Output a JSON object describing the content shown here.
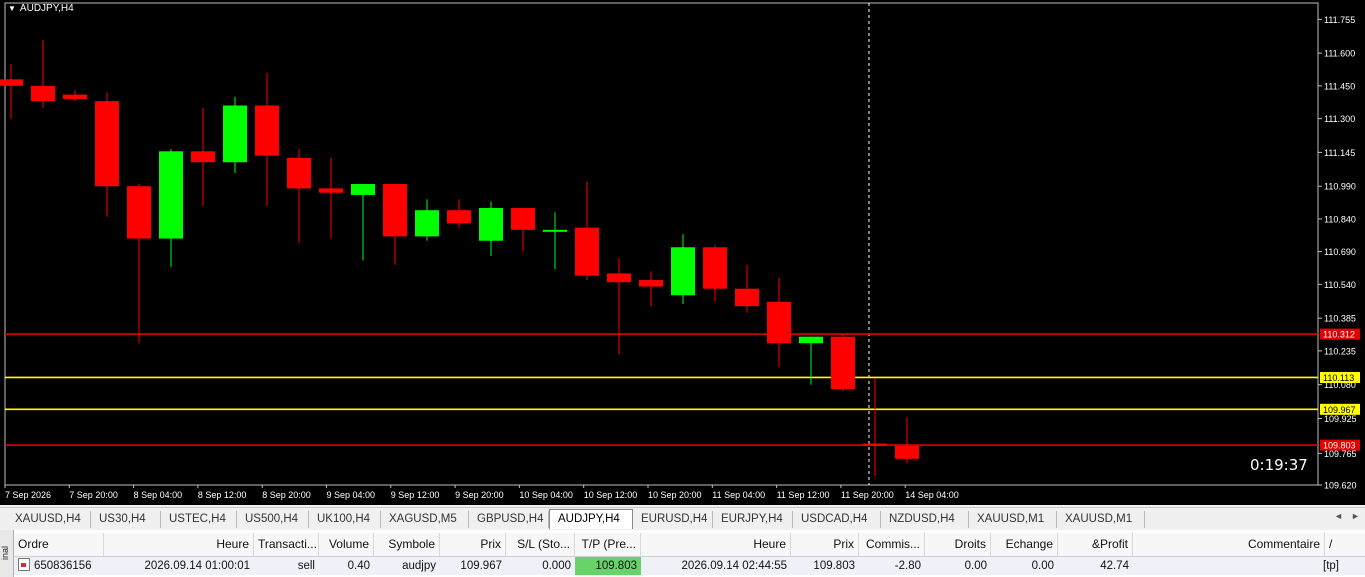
{
  "chart": {
    "title": "AUDJPY,H4",
    "countdown": "0:19:37",
    "background": "#000000",
    "bull_color": "#00ff00",
    "bear_color": "#ff0000",
    "price_axis": {
      "min": 109.62,
      "max": 111.83,
      "ticks": [
        "111.755",
        "111.600",
        "111.450",
        "111.300",
        "111.145",
        "110.990",
        "110.840",
        "110.690",
        "110.540",
        "110.385",
        "110.235",
        "110.080",
        "109.925",
        "109.765",
        "109.620"
      ]
    },
    "time_labels": [
      "7 Sep 2026",
      "7 Sep 20:00",
      "8 Sep 04:00",
      "8 Sep 12:00",
      "8 Sep 20:00",
      "9 Sep 04:00",
      "9 Sep 12:00",
      "9 Sep 20:00",
      "10 Sep 04:00",
      "10 Sep 12:00",
      "10 Sep 20:00",
      "11 Sep 04:00",
      "11 Sep 12:00",
      "11 Sep 20:00",
      "14 Sep 04:00"
    ],
    "levels": [
      {
        "price": 110.312,
        "label": "110.312",
        "color": "#e00000",
        "label_bg": "#e00000",
        "label_fg": "#ffffff"
      },
      {
        "price": 110.113,
        "label": "110.113",
        "color": "#ffff00",
        "label_bg": "#ffff00",
        "label_fg": "#000000"
      },
      {
        "price": 109.967,
        "label": "109.967",
        "color": "#ffff00",
        "label_bg": "#ffff00",
        "label_fg": "#000000"
      },
      {
        "price": 109.803,
        "label": "109.803",
        "color": "#e00000",
        "label_bg": "#e00000",
        "label_fg": "#ffffff"
      }
    ],
    "candles": [
      {
        "o": 111.48,
        "h": 111.55,
        "l": 111.3,
        "c": 111.45
      },
      {
        "o": 111.45,
        "h": 111.66,
        "l": 111.35,
        "c": 111.38
      },
      {
        "o": 111.41,
        "h": 111.43,
        "l": 111.38,
        "c": 111.39
      },
      {
        "o": 111.38,
        "h": 111.42,
        "l": 110.85,
        "c": 110.99
      },
      {
        "o": 110.99,
        "h": 111.0,
        "l": 110.27,
        "c": 110.75
      },
      {
        "o": 110.75,
        "h": 111.16,
        "l": 110.62,
        "c": 111.15
      },
      {
        "o": 111.15,
        "h": 111.35,
        "l": 110.9,
        "c": 111.1
      },
      {
        "o": 111.1,
        "h": 111.4,
        "l": 111.05,
        "c": 111.36
      },
      {
        "o": 111.36,
        "h": 111.51,
        "l": 110.9,
        "c": 111.13
      },
      {
        "o": 111.12,
        "h": 111.16,
        "l": 110.73,
        "c": 110.98
      },
      {
        "o": 110.98,
        "h": 111.12,
        "l": 110.75,
        "c": 110.96
      },
      {
        "o": 110.95,
        "h": 111.0,
        "l": 110.65,
        "c": 111.0
      },
      {
        "o": 111.0,
        "h": 111.0,
        "l": 110.63,
        "c": 110.76
      },
      {
        "o": 110.76,
        "h": 110.93,
        "l": 110.74,
        "c": 110.88
      },
      {
        "o": 110.88,
        "h": 110.93,
        "l": 110.8,
        "c": 110.82
      },
      {
        "o": 110.74,
        "h": 110.92,
        "l": 110.67,
        "c": 110.89
      },
      {
        "o": 110.89,
        "h": 110.89,
        "l": 110.69,
        "c": 110.79
      },
      {
        "o": 110.79,
        "h": 110.87,
        "l": 110.61,
        "c": 110.79
      },
      {
        "o": 110.8,
        "h": 111.01,
        "l": 110.56,
        "c": 110.58
      },
      {
        "o": 110.59,
        "h": 110.66,
        "l": 110.22,
        "c": 110.55
      },
      {
        "o": 110.56,
        "h": 110.6,
        "l": 110.44,
        "c": 110.53
      },
      {
        "o": 110.49,
        "h": 110.77,
        "l": 110.45,
        "c": 110.71
      },
      {
        "o": 110.71,
        "h": 110.72,
        "l": 110.46,
        "c": 110.52
      },
      {
        "o": 110.52,
        "h": 110.63,
        "l": 110.41,
        "c": 110.44
      },
      {
        "o": 110.46,
        "h": 110.57,
        "l": 110.16,
        "c": 110.27
      },
      {
        "o": 110.27,
        "h": 110.3,
        "l": 110.08,
        "c": 110.3
      },
      {
        "o": 110.3,
        "h": 110.31,
        "l": 110.05,
        "c": 110.06
      },
      {
        "o": 109.81,
        "h": 110.11,
        "l": 109.66,
        "c": 109.8
      },
      {
        "o": 109.8,
        "h": 109.93,
        "l": 109.72,
        "c": 109.74
      }
    ]
  },
  "tabs": [
    {
      "label": "XAUUSD,H4",
      "active": false
    },
    {
      "label": "US30,H4",
      "active": false
    },
    {
      "label": "USTEC,H4",
      "active": false
    },
    {
      "label": "US500,H4",
      "active": false
    },
    {
      "label": "UK100,H4",
      "active": false
    },
    {
      "label": "XAGUSD,M5",
      "active": false
    },
    {
      "label": "GBPUSD,H4",
      "active": false
    },
    {
      "label": "AUDJPY,H4",
      "active": true
    },
    {
      "label": "EURUSD,H4",
      "active": false
    },
    {
      "label": "EURJPY,H4",
      "active": false
    },
    {
      "label": "USDCAD,H4",
      "active": false
    },
    {
      "label": "NZDUSD,H4",
      "active": false
    },
    {
      "label": "XAUUSD,M1",
      "active": false
    },
    {
      "label": "XAUUSD,M1",
      "active": false
    }
  ],
  "tab_nav": {
    "left": "◄",
    "right": "►"
  },
  "terminal": {
    "side_label": "inal",
    "columns": [
      "Ordre",
      "Heure",
      "Transacti...",
      "Volume",
      "Symbole",
      "Prix",
      "S/L (Sto...",
      "T/P (Pre...",
      "Heure",
      "Prix",
      "Commis...",
      "Droits",
      "Echange",
      "&Profit",
      "Commentaire"
    ],
    "sort_indicator": "/",
    "row": {
      "order": "650836156",
      "open_time": "2026.09.14 01:00:01",
      "type": "sell",
      "volume": "0.40",
      "symbol": "audjpy",
      "price": "109.967",
      "sl": "0.000",
      "tp": "109.803",
      "close_time": "2026.09.14 02:44:55",
      "close_price": "109.803",
      "commission": "-2.80",
      "swap_rights": "0.00",
      "exchange": "0.00",
      "profit": "42.74",
      "comment": "[tp]"
    }
  }
}
